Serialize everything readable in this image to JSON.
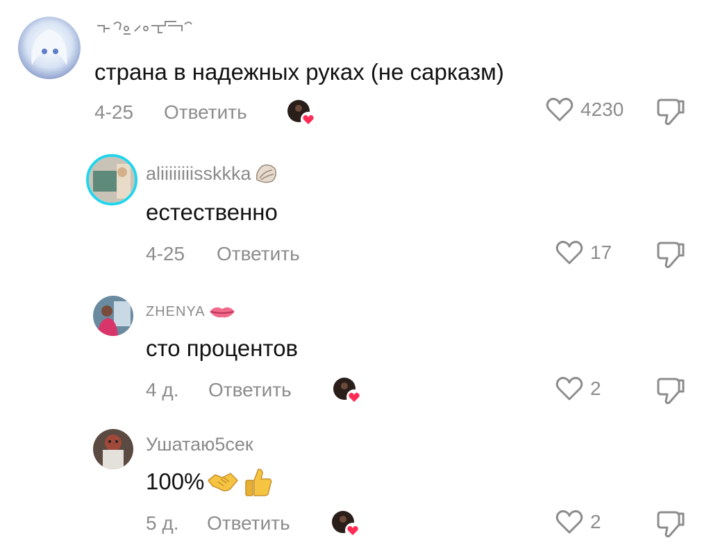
{
  "comments": [
    {
      "username": "",
      "text": "страна в надежных руках (не сарказм)",
      "date": "4-25",
      "reply_label": "Ответить",
      "likes": "4230",
      "liked_by_creator": true
    },
    {
      "username": "aliiiiiiiisskkka",
      "username_emoji": "shell",
      "text": "естественно",
      "date": "4-25",
      "reply_label": "Ответить",
      "likes": "17",
      "liked_by_creator": false
    },
    {
      "username": "ZHENYA",
      "username_emoji": "lips",
      "text": "сто процентов",
      "date": "4 д.",
      "reply_label": "Ответить",
      "likes": "2",
      "liked_by_creator": true
    },
    {
      "username": "Ушатаю5сек",
      "text": "100%",
      "text_emoji": [
        "handshake",
        "thumbs-up"
      ],
      "date": "5 д.",
      "reply_label": "Ответить",
      "likes": "2",
      "liked_by_creator": true
    }
  ],
  "colors": {
    "text": "#111111",
    "muted": "#8c8c8c",
    "heart_badge": "#fe2c55",
    "story_ring": "#20d5ec"
  }
}
